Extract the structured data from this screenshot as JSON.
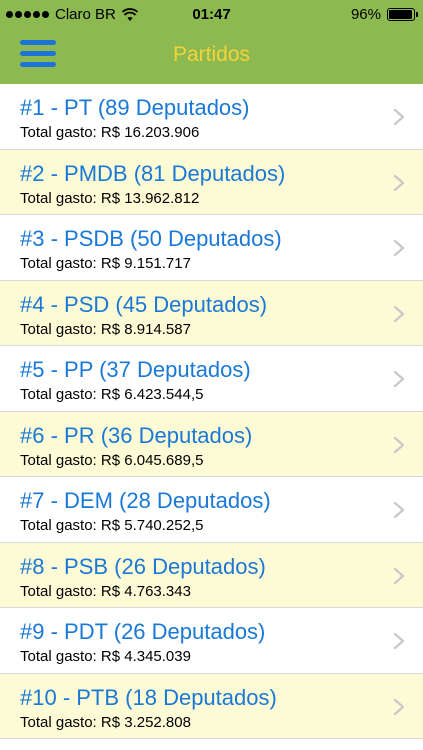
{
  "status_bar": {
    "carrier": "Claro BR",
    "time": "01:47",
    "battery": "96%",
    "battery_level": 0.96,
    "icons": [
      "signal-dots",
      "wifi-icon",
      "battery-icon"
    ]
  },
  "nav": {
    "title": "Partidos",
    "menu_icon": "hamburger-menu-icon",
    "colors": {
      "bar": "#8cba51",
      "title": "#f6d23a",
      "menu": "#1e73d8"
    }
  },
  "list": {
    "colors": {
      "title": "#1a78d6",
      "row_odd": "#ffffff",
      "row_even": "#fdfbd6"
    },
    "items": [
      {
        "title": "#1 - PT (89 Deputados)",
        "subtitle": "Total gasto: R$ 16.203.906"
      },
      {
        "title": "#2 - PMDB (81 Deputados)",
        "subtitle": "Total gasto: R$ 13.962.812"
      },
      {
        "title": "#3 - PSDB (50 Deputados)",
        "subtitle": "Total gasto: R$ 9.151.717"
      },
      {
        "title": "#4 - PSD (45 Deputados)",
        "subtitle": "Total gasto: R$ 8.914.587"
      },
      {
        "title": "#5 - PP (37 Deputados)",
        "subtitle": "Total gasto: R$ 6.423.544,5"
      },
      {
        "title": "#6 - PR (36 Deputados)",
        "subtitle": "Total gasto: R$ 6.045.689,5"
      },
      {
        "title": "#7 - DEM (28 Deputados)",
        "subtitle": "Total gasto: R$ 5.740.252,5"
      },
      {
        "title": "#8 - PSB (26 Deputados)",
        "subtitle": "Total gasto: R$ 4.763.343"
      },
      {
        "title": "#9 - PDT (26 Deputados)",
        "subtitle": "Total gasto: R$ 4.345.039"
      },
      {
        "title": "#10 - PTB (18 Deputados)",
        "subtitle": "Total gasto: R$ 3.252.808"
      }
    ]
  }
}
